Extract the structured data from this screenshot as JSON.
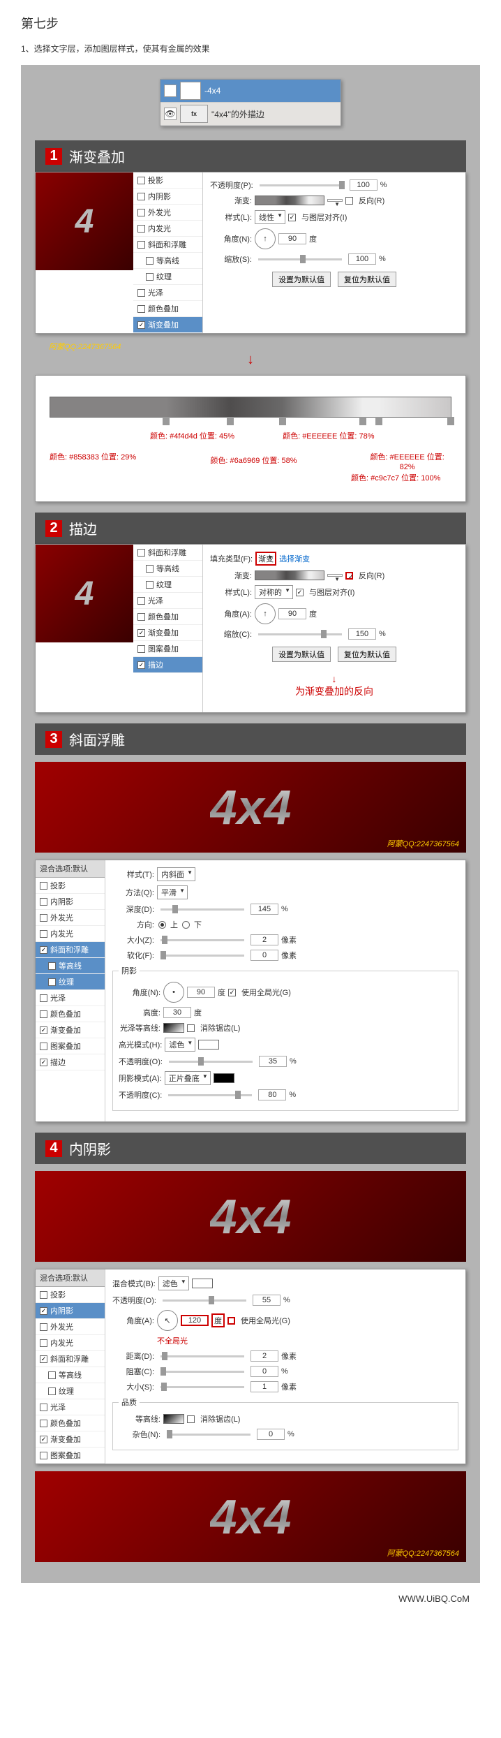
{
  "title": "第七步",
  "desc": "1、选择文字层，添加图层样式，使其有金属的效果",
  "layers": {
    "l1": "-4x4",
    "l2": "\"4x4\"的外描边"
  },
  "sections": {
    "s1_num": "1",
    "s1_title": "渐变叠加",
    "s2_num": "2",
    "s2_title": "描边",
    "s3_num": "3",
    "s3_title": "斜面浮雕",
    "s4_num": "4",
    "s4_title": "内阴影"
  },
  "styleList": {
    "header": "混合选项:默认",
    "dropShadow": "投影",
    "innerShadow": "内阴影",
    "outerGlow": "外发光",
    "innerGlow": "内发光",
    "bevel": "斜面和浮雕",
    "contour": "等高线",
    "texture": "纹理",
    "satin": "光泽",
    "colorOverlay": "颜色叠加",
    "gradOverlay": "渐变叠加",
    "patternOverlay": "图案叠加",
    "stroke": "描边"
  },
  "s1": {
    "opacity_label": "不透明度(P):",
    "opacity_val": "100",
    "pct": "%",
    "reverse": "反向(R)",
    "grad_label": "渐变:",
    "style_label": "样式(L):",
    "style_val": "线性",
    "align": "与图层对齐(I)",
    "angle_label": "角度(N):",
    "angle_val": "90",
    "deg": "度",
    "scale_label": "缩放(S):",
    "scale_val": "100",
    "set_default": "设置为默认值",
    "reset_default": "复位为默认值",
    "stops": {
      "g1": "颜色: #858383\n位置: 29%",
      "g2": "颜色: #4f4d4d\n位置: 45%",
      "g3": "颜色: #6a6969\n位置: 58%",
      "g4": "颜色: #EEEEEE\n位置: 78%",
      "g5": "颜色: #EEEEEE\n位置: 82%",
      "g6": "颜色: #c9c7c7\n位置: 100%"
    }
  },
  "s2": {
    "fillType_label": "填充类型(F):",
    "fillType_val": "渐变",
    "select_grad": "选择渐变",
    "reverse": "反向(R)",
    "grad_label": "渐变:",
    "style_label": "样式(L):",
    "style_val": "对称的",
    "align": "与图层对齐(I)",
    "angle_label": "角度(A):",
    "angle_val": "90",
    "deg": "度",
    "scale_label": "缩放(C):",
    "scale_val": "150",
    "pct": "%",
    "set_default": "设置为默认值",
    "reset_default": "复位为默认值",
    "note": "为渐变叠加的反向"
  },
  "watermark": "阿蒙QQ:2247367564",
  "previewText": "4x4",
  "s3": {
    "style_label": "样式(T):",
    "style_val": "内斜面",
    "method_label": "方法(Q):",
    "method_val": "平滑",
    "depth_label": "深度(D):",
    "depth_val": "145",
    "pct": "%",
    "dir_label": "方向:",
    "up": "上",
    "down": "下",
    "size_label": "大小(Z):",
    "size_val": "2",
    "px": "像素",
    "soft_label": "软化(F):",
    "soft_val": "0",
    "shading": "阴影",
    "angle_label": "角度(N):",
    "angle_val": "90",
    "deg": "度",
    "global": "使用全局光(G)",
    "alt_label": "高度:",
    "alt_val": "30",
    "gloss_label": "光泽等高线:",
    "anti": "消除锯齿(L)",
    "hilite_label": "高光模式(H):",
    "hilite_val": "滤色",
    "hopacity_label": "不透明度(O):",
    "hopacity_val": "35",
    "shadow_label": "阴影模式(A):",
    "shadow_val": "正片叠底",
    "sopacity_label": "不透明度(C):",
    "sopacity_val": "80"
  },
  "s4": {
    "blend_label": "混合模式(B):",
    "blend_val": "滤色",
    "opacity_label": "不透明度(O):",
    "opacity_val": "55",
    "pct": "%",
    "angle_label": "角度(A):",
    "angle_val": "120",
    "deg": "度",
    "global": "使用全局光(G)",
    "no_global": "不全局光",
    "dist_label": "距离(D):",
    "dist_val": "2",
    "px": "像素",
    "choke_label": "阻塞(C):",
    "choke_val": "0",
    "size_label": "大小(S):",
    "size_val": "1",
    "quality": "品质",
    "contour_label": "等高线:",
    "anti": "消除锯齿(L)",
    "noise_label": "杂色(N):",
    "noise_val": "0"
  },
  "footer": "WWW.UiBQ.CoM"
}
